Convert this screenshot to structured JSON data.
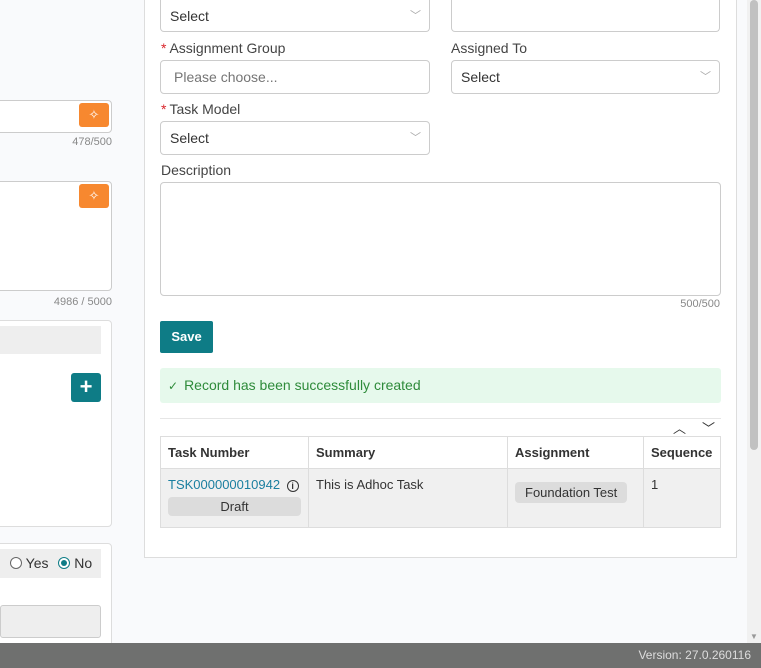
{
  "left": {
    "counter1": "478/500",
    "counter2": "4986 / 5000",
    "add_label": "+",
    "radio_yes": "Yes",
    "radio_no": "No"
  },
  "form": {
    "top_select": "Select",
    "assignment_group_label": "Assignment Group",
    "assignment_group_placeholder": "Please choose...",
    "assigned_to_label": "Assigned To",
    "assigned_to_value": "Select",
    "task_model_label": "Task Model",
    "task_model_value": "Select",
    "description_label": "Description",
    "description_counter": "500/500",
    "save_label": "Save",
    "success_message": "Record has been successfully created"
  },
  "table": {
    "headers": [
      "Task Number",
      "Summary",
      "Assignment",
      "Sequence"
    ],
    "rows": [
      {
        "task_number": "TSK000000010942",
        "status": "Draft",
        "summary": "This is Adhoc Task",
        "assignment": "Foundation Test",
        "sequence": "1"
      }
    ]
  },
  "footer": {
    "version": "Version: 27.0.260116"
  },
  "colors": {
    "accent": "#0e7c86",
    "ai": "#f7882f",
    "success_bg": "#e6f9ec",
    "success_text": "#2e8b3a"
  }
}
